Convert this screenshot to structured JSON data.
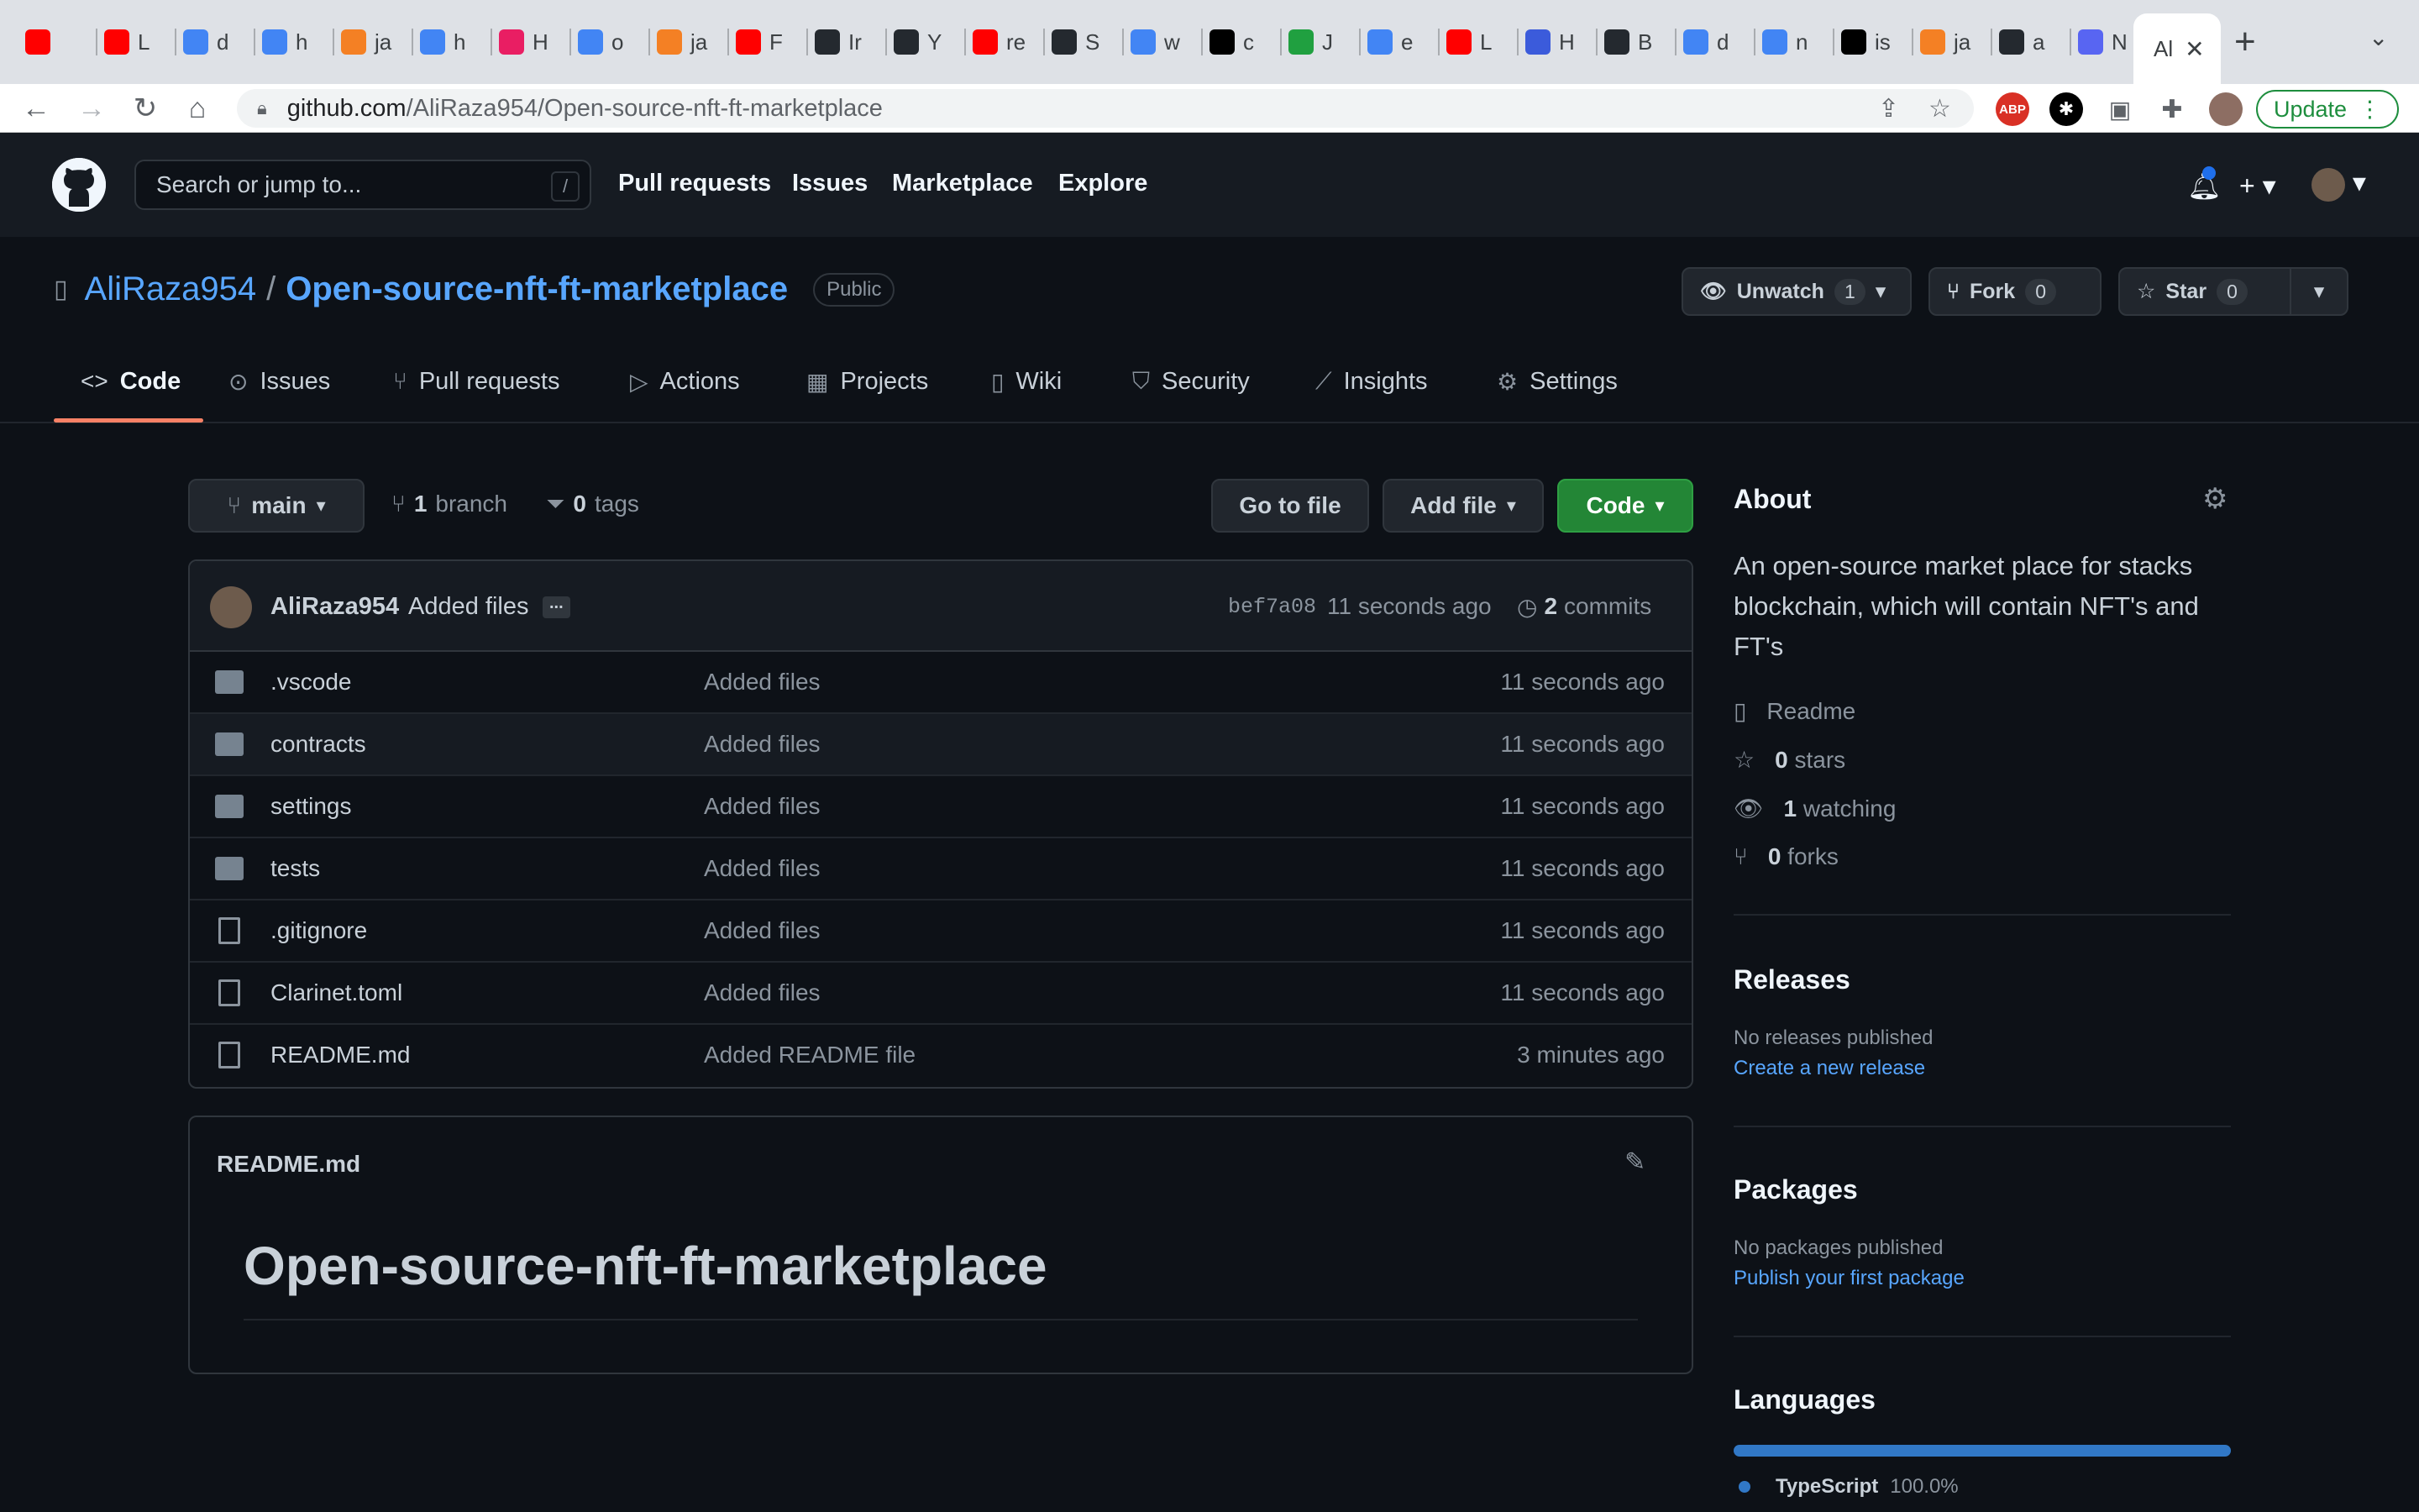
{
  "browser": {
    "tabs": [
      {
        "letter": "",
        "color": "#ff0000"
      },
      {
        "letter": "L",
        "color": "#ff0000"
      },
      {
        "letter": "d",
        "color": "#4285f4"
      },
      {
        "letter": "h",
        "color": "#4285f4"
      },
      {
        "letter": "ja",
        "color": "#f48024"
      },
      {
        "letter": "h",
        "color": "#4285f4"
      },
      {
        "letter": "H",
        "color": "#e91e63"
      },
      {
        "letter": "o",
        "color": "#4285f4"
      },
      {
        "letter": "ja",
        "color": "#f48024"
      },
      {
        "letter": "F",
        "color": "#ff0000"
      },
      {
        "letter": "Ir",
        "color": "#24292f"
      },
      {
        "letter": "Y",
        "color": "#24292f"
      },
      {
        "letter": "re",
        "color": "#ff0000"
      },
      {
        "letter": "S",
        "color": "#24292f"
      },
      {
        "letter": "w",
        "color": "#4285f4"
      },
      {
        "letter": "c",
        "color": "#000000"
      },
      {
        "letter": "J",
        "color": "#20a040"
      },
      {
        "letter": "e",
        "color": "#4285f4"
      },
      {
        "letter": "L",
        "color": "#ff0000"
      },
      {
        "letter": "H",
        "color": "#3b5bdb"
      },
      {
        "letter": "B",
        "color": "#24292f"
      },
      {
        "letter": "d",
        "color": "#4285f4"
      },
      {
        "letter": "n",
        "color": "#4285f4"
      },
      {
        "letter": "is",
        "color": "#000000"
      },
      {
        "letter": "ja",
        "color": "#f48024"
      },
      {
        "letter": "a",
        "color": "#24292f"
      },
      {
        "letter": "N",
        "color": "#5865f2"
      }
    ],
    "active_tab": "Al",
    "url_host": "github.com",
    "url_path": "/AliRaza954/Open-source-nft-ft-marketplace",
    "update_label": "Update",
    "abp_label": "ABP"
  },
  "gh": {
    "search_placeholder": "Search or jump to...",
    "search_key": "/",
    "nav": [
      "Pull requests",
      "Issues",
      "Marketplace",
      "Explore"
    ]
  },
  "repo": {
    "owner": "AliRaza954",
    "separator": "/",
    "name": "Open-source-nft-ft-marketplace",
    "visibility": "Public",
    "unwatch_label": "Unwatch",
    "watch_count": "1",
    "fork_label": "Fork",
    "fork_count": "0",
    "star_label": "Star",
    "star_count": "0",
    "tabs": [
      "Code",
      "Issues",
      "Pull requests",
      "Actions",
      "Projects",
      "Wiki",
      "Security",
      "Insights",
      "Settings"
    ]
  },
  "toolbar": {
    "branch": "main",
    "branch_count": "1",
    "branch_label": "branch",
    "tag_count": "0",
    "tag_label": "tags",
    "go_to_file": "Go to file",
    "add_file": "Add file",
    "code": "Code"
  },
  "commit": {
    "author": "AliRaza954",
    "message": "Added files",
    "ellipsis": "...",
    "sha": "bef7a08",
    "age": "11 seconds ago",
    "count": "2",
    "count_label": "commits"
  },
  "files": [
    {
      "name": ".vscode",
      "type": "dir",
      "message": "Added files",
      "age": "11 seconds ago"
    },
    {
      "name": "contracts",
      "type": "dir",
      "message": "Added files",
      "age": "11 seconds ago"
    },
    {
      "name": "settings",
      "type": "dir",
      "message": "Added files",
      "age": "11 seconds ago"
    },
    {
      "name": "tests",
      "type": "dir",
      "message": "Added files",
      "age": "11 seconds ago"
    },
    {
      "name": ".gitignore",
      "type": "file",
      "message": "Added files",
      "age": "11 seconds ago"
    },
    {
      "name": "Clarinet.toml",
      "type": "file",
      "message": "Added files",
      "age": "11 seconds ago"
    },
    {
      "name": "README.md",
      "type": "file",
      "message": "Added README file",
      "age": "3 minutes ago"
    }
  ],
  "readme": {
    "filename": "README.md",
    "heading": "Open-source-nft-ft-marketplace"
  },
  "about": {
    "title": "About",
    "description": "An open-source market place for stacks blockchain, which will contain NFT's and FT's",
    "readme_label": "Readme",
    "stars_count": "0",
    "stars_label": "stars",
    "watching_count": "1",
    "watching_label": "watching",
    "forks_count": "0",
    "forks_label": "forks"
  },
  "releases": {
    "title": "Releases",
    "empty": "No releases published",
    "link": "Create a new release"
  },
  "packages": {
    "title": "Packages",
    "empty": "No packages published",
    "link": "Publish your first package"
  },
  "languages": {
    "title": "Languages",
    "items": [
      {
        "name": "TypeScript",
        "percent": "100.0%",
        "fraction": 1.0,
        "color": "#3178c6"
      }
    ]
  }
}
